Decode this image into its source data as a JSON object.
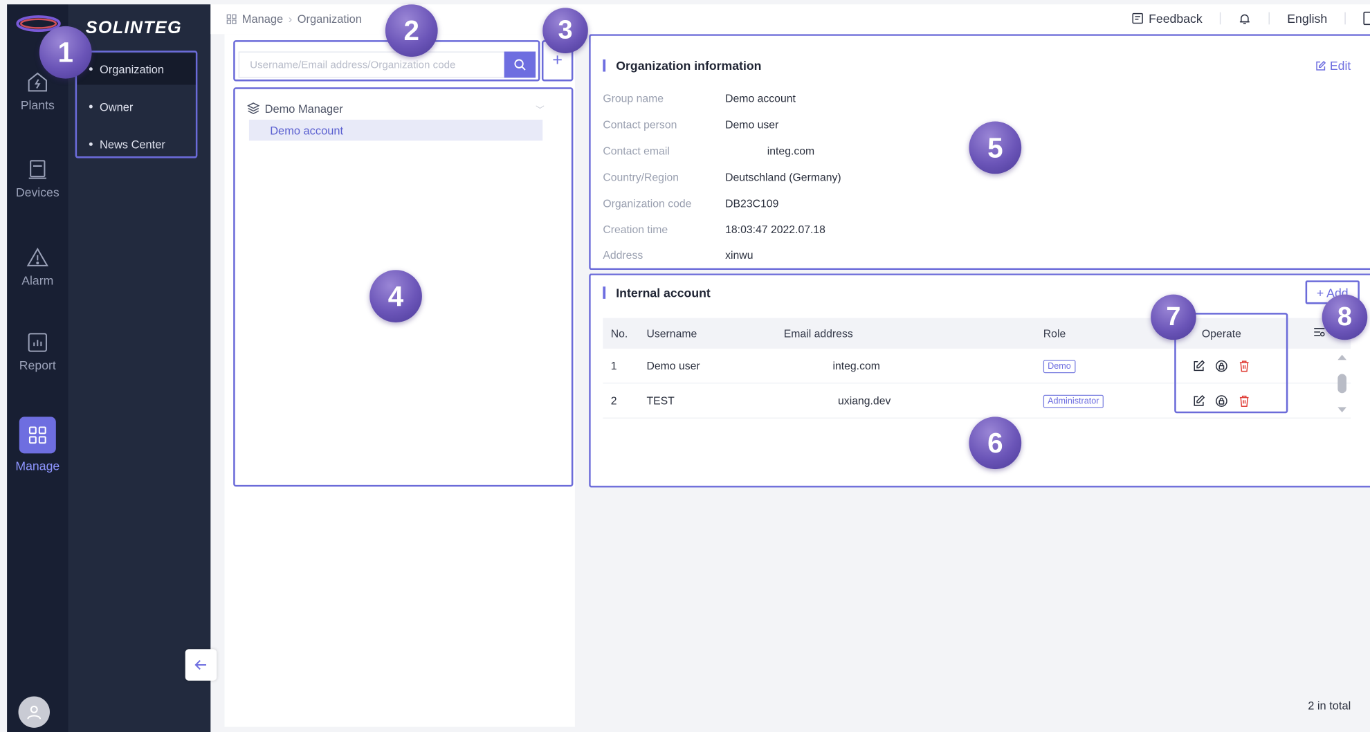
{
  "brand": {
    "name": "SOLINTEG"
  },
  "rail": {
    "items": [
      {
        "label": "Plants",
        "icon": "plant-icon"
      },
      {
        "label": "Devices",
        "icon": "device-icon"
      },
      {
        "label": "Alarm",
        "icon": "alarm-icon"
      },
      {
        "label": "Report",
        "icon": "report-icon"
      },
      {
        "label": "Manage",
        "icon": "manage-icon",
        "active": true
      }
    ]
  },
  "subnav": {
    "items": [
      {
        "label": "Organization",
        "active": true
      },
      {
        "label": "Owner"
      },
      {
        "label": "News Center"
      }
    ]
  },
  "breadcrumb": {
    "root": "Manage",
    "current": "Organization"
  },
  "topbar": {
    "feedback": "Feedback",
    "language": "English"
  },
  "search": {
    "placeholder": "Username/Email address/Organization code"
  },
  "tree": {
    "root": "Demo Manager",
    "child": "Demo account"
  },
  "org_info": {
    "title": "Organization information",
    "edit_label": "Edit",
    "rows": [
      {
        "label": "Group name",
        "value": "Demo account"
      },
      {
        "label": "Contact person",
        "value": "Demo user"
      },
      {
        "label": "Contact email",
        "value": "integ.com"
      },
      {
        "label": "Country/Region",
        "value": "Deutschland (Germany)"
      },
      {
        "label": "Organization code",
        "value": "DB23C109"
      },
      {
        "label": "Creation time",
        "value": "18:03:47 2022.07.18"
      },
      {
        "label": "Address",
        "value": "xinwu"
      }
    ]
  },
  "internal_account": {
    "title": "Internal account",
    "add_label": "+ Add",
    "columns": {
      "no": "No.",
      "username": "Username",
      "email": "Email address",
      "role": "Role",
      "operate": "Operate"
    },
    "rows": [
      {
        "no": "1",
        "username": "Demo user",
        "email": "integ.com",
        "role": "Demo"
      },
      {
        "no": "2",
        "username": "TEST",
        "email": "uxiang.dev",
        "role": "Administrator"
      }
    ],
    "total": "2 in total"
  },
  "callouts": [
    "1",
    "2",
    "3",
    "4",
    "5",
    "6",
    "7",
    "8"
  ],
  "colors": {
    "accent": "#6e6ee0",
    "rail_bg": "#181f33",
    "subnav_bg": "#222a3e",
    "callout": "#6b55b8",
    "delete": "#e0413a"
  }
}
